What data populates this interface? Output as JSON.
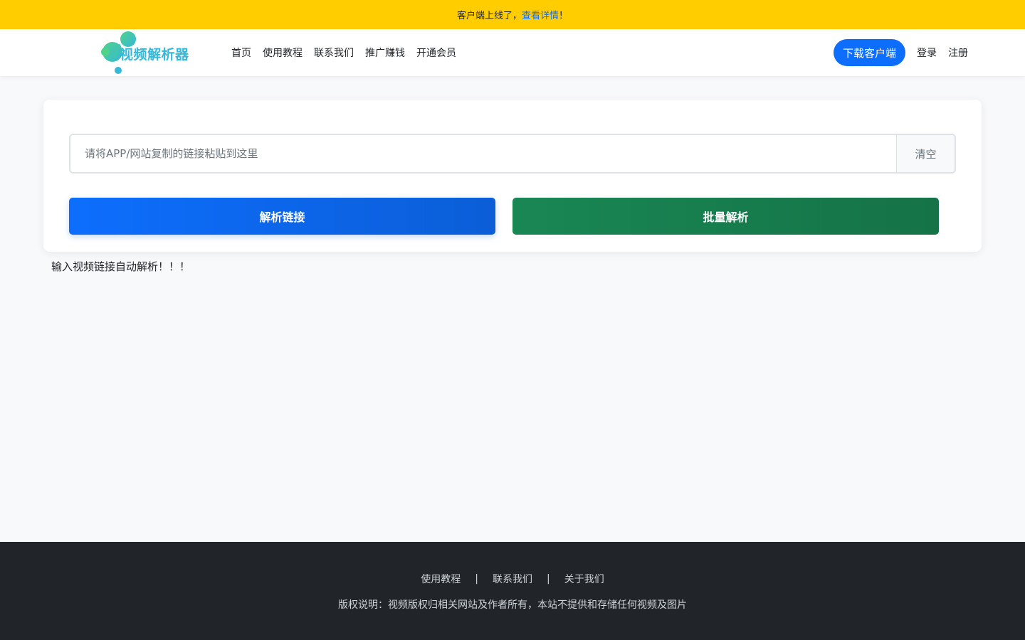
{
  "announcement": {
    "prefix": "客户端上线了，",
    "link": "查看详情",
    "suffix": "！"
  },
  "navbar": {
    "logo_text": "视频解析器",
    "links": [
      "首页",
      "使用教程",
      "联系我们",
      "推广赚钱",
      "开通会员"
    ],
    "download_label": "下载客户端",
    "login_label": "登录",
    "register_label": "注册"
  },
  "parser": {
    "input_placeholder": "请将APP/网站复制的链接粘贴到这里",
    "input_value": "",
    "clear_label": "清空",
    "parse_label": "解析链接",
    "batch_label": "批量解析",
    "hint": "输入视频链接自动解析！！！"
  },
  "footer": {
    "links": [
      "使用教程",
      "联系我们",
      "关于我们"
    ],
    "separator": "|",
    "copyright": "版权说明：视频版权归相关网站及作者所有，本站不提供和存储任何视频及图片"
  },
  "colors": {
    "announcement_bg": "#ffcd00",
    "primary": "#0d6efd",
    "success": "#198754",
    "footer_bg": "#212529",
    "logo": "#36b8d8"
  }
}
